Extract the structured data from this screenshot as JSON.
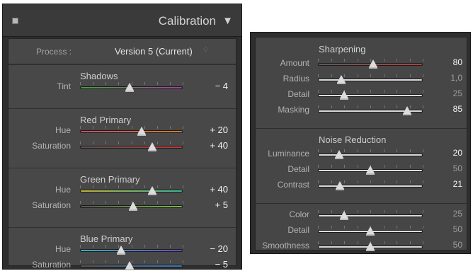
{
  "left_panel": {
    "title": "Calibration",
    "collapse_icon": "square-toggle-icon",
    "triangle_icon": "triangle-down-icon",
    "process_label": "Process :",
    "process_value": "Version 5 (Current)",
    "process_chevron": "♢",
    "sections": [
      {
        "title": "Shadows",
        "rows": [
          {
            "label": "Tint",
            "value": "− 4",
            "position": 0.48,
            "track": [
              "#3fa23f",
              "#a33ea3"
            ]
          }
        ]
      },
      {
        "title": "Red Primary",
        "rows": [
          {
            "label": "Hue",
            "value": "+ 20",
            "position": 0.6,
            "track": [
              "#c84d6a",
              "#c8802e"
            ]
          },
          {
            "label": "Saturation",
            "value": "+ 40",
            "position": 0.7,
            "track": [
              "#555555",
              "#c03a3a"
            ]
          }
        ]
      },
      {
        "title": "Green Primary",
        "rows": [
          {
            "label": "Hue",
            "value": "+ 40",
            "position": 0.7,
            "track": [
              "#c4b63a",
              "#3ab89a"
            ]
          },
          {
            "label": "Saturation",
            "value": "+ 5",
            "position": 0.52,
            "track": [
              "#555555",
              "#7ab84a"
            ]
          }
        ]
      },
      {
        "title": "Blue Primary",
        "rows": [
          {
            "label": "Hue",
            "value": "− 20",
            "position": 0.4,
            "track": [
              "#3ab0b8",
              "#6a4ac0"
            ]
          },
          {
            "label": "Saturation",
            "value": "− 5",
            "position": 0.48,
            "track": [
              "#555555",
              "#3a7ac0"
            ]
          }
        ]
      }
    ]
  },
  "right_panel": {
    "sections": [
      {
        "title": "Sharpening",
        "rows": [
          {
            "label": "Amount",
            "value": "80",
            "position": 0.53,
            "highlight": true,
            "track": [
              "#5a5a5a",
              "#b04040"
            ]
          },
          {
            "label": "Radius",
            "value": "1,0",
            "position": 0.22,
            "highlight": false,
            "track": [
              "#dcdcdc",
              "#dcdcdc"
            ]
          },
          {
            "label": "Detail",
            "value": "25",
            "position": 0.25,
            "highlight": false,
            "track": [
              "#dcdcdc",
              "#dcdcdc"
            ]
          },
          {
            "label": "Masking",
            "value": "85",
            "position": 0.85,
            "highlight": true,
            "track": [
              "#dcdcdc",
              "#dcdcdc"
            ]
          }
        ]
      },
      {
        "title": "Noise Reduction",
        "rows": [
          {
            "label": "Luminance",
            "value": "20",
            "position": 0.2,
            "highlight": true,
            "track": [
              "#dcdcdc",
              "#dcdcdc"
            ]
          },
          {
            "label": "Detail",
            "value": "50",
            "position": 0.5,
            "highlight": false,
            "track": [
              "#dcdcdc",
              "#dcdcdc"
            ]
          },
          {
            "label": "Contrast",
            "value": "21",
            "position": 0.21,
            "highlight": true,
            "track": [
              "#dcdcdc",
              "#dcdcdc"
            ]
          }
        ]
      },
      {
        "title": "",
        "rows": [
          {
            "label": "Color",
            "value": "25",
            "position": 0.25,
            "highlight": false,
            "track": [
              "#dcdcdc",
              "#dcdcdc"
            ]
          },
          {
            "label": "Detail",
            "value": "50",
            "position": 0.5,
            "highlight": false,
            "track": [
              "#dcdcdc",
              "#dcdcdc"
            ]
          },
          {
            "label": "Smoothness",
            "value": "50",
            "position": 0.5,
            "highlight": false,
            "track": [
              "#dcdcdc",
              "#dcdcdc"
            ]
          }
        ]
      }
    ],
    "value_colors": {
      "highlight": "#f4f4f4",
      "normal": "#9c9c9c"
    }
  }
}
